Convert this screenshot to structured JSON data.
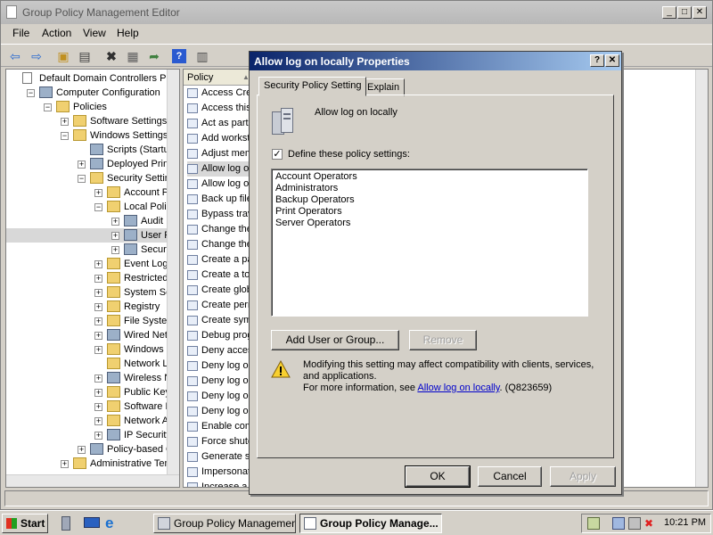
{
  "window": {
    "title": "Group Policy Management Editor",
    "min": "_",
    "max": "□",
    "close": "✕"
  },
  "menu": [
    "File",
    "Action",
    "View",
    "Help"
  ],
  "tree": [
    {
      "label": "Default Domain Controllers Polic",
      "indent": 0,
      "exp": "",
      "icon": "doc"
    },
    {
      "label": "Computer Configuration",
      "indent": 1,
      "exp": "−",
      "icon": "gear"
    },
    {
      "label": "Policies",
      "indent": 2,
      "exp": "−",
      "icon": "folder"
    },
    {
      "label": "Software Settings",
      "indent": 3,
      "exp": "+",
      "icon": "folder"
    },
    {
      "label": "Windows Settings",
      "indent": 3,
      "exp": "−",
      "icon": "folder"
    },
    {
      "label": "Scripts (Startup",
      "indent": 4,
      "exp": "",
      "icon": "gear"
    },
    {
      "label": "Deployed Printe",
      "indent": 4,
      "exp": "+",
      "icon": "gear"
    },
    {
      "label": "Security Setting",
      "indent": 4,
      "exp": "−",
      "icon": "lock"
    },
    {
      "label": "Account Pol",
      "indent": 5,
      "exp": "+",
      "icon": "folder"
    },
    {
      "label": "Local Policie",
      "indent": 5,
      "exp": "−",
      "icon": "folder"
    },
    {
      "label": "Audit Po",
      "indent": 6,
      "exp": "+",
      "icon": "gear"
    },
    {
      "label": "User Rig",
      "indent": 6,
      "exp": "+",
      "icon": "gear"
    },
    {
      "label": "Security",
      "indent": 6,
      "exp": "+",
      "icon": "gear"
    },
    {
      "label": "Event Log",
      "indent": 5,
      "exp": "+",
      "icon": "folder"
    },
    {
      "label": "Restricted G",
      "indent": 5,
      "exp": "+",
      "icon": "lock"
    },
    {
      "label": "System Serv",
      "indent": 5,
      "exp": "+",
      "icon": "lock"
    },
    {
      "label": "Registry",
      "indent": 5,
      "exp": "+",
      "icon": "lock"
    },
    {
      "label": "File System",
      "indent": 5,
      "exp": "+",
      "icon": "lock"
    },
    {
      "label": "Wired Netw",
      "indent": 5,
      "exp": "+",
      "icon": "gear"
    },
    {
      "label": "Windows Fir",
      "indent": 5,
      "exp": "+",
      "icon": "folder"
    },
    {
      "label": "Network Lis",
      "indent": 5,
      "exp": "",
      "icon": "folder"
    },
    {
      "label": "Wireless Ne",
      "indent": 5,
      "exp": "+",
      "icon": "gear"
    },
    {
      "label": "Public Key P",
      "indent": 5,
      "exp": "+",
      "icon": "folder"
    },
    {
      "label": "Software Re",
      "indent": 5,
      "exp": "+",
      "icon": "folder"
    },
    {
      "label": "Network Ac",
      "indent": 5,
      "exp": "+",
      "icon": "folder"
    },
    {
      "label": "IP Security",
      "indent": 5,
      "exp": "+",
      "icon": "gear"
    },
    {
      "label": "Policy-based Qo",
      "indent": 4,
      "exp": "+",
      "icon": "gear"
    },
    {
      "label": "Administrative Temp",
      "indent": 3,
      "exp": "+",
      "icon": "folder"
    }
  ],
  "list": {
    "column": "Policy",
    "items": [
      "Access Cre",
      "Access this",
      "Act as part",
      "Add workst",
      "Adjust mem",
      "Allow log on",
      "Allow log on",
      "Back up file",
      "Bypass trav",
      "Change the",
      "Change the",
      "Create a pa",
      "Create a to",
      "Create glob",
      "Create perm",
      "Create sym",
      "Debug prog",
      "Deny acces",
      "Deny log on",
      "Deny log on",
      "Deny log on",
      "Deny log on",
      "Enable com",
      "Force shutd",
      "Generate se",
      "Impersonat",
      "Increase a"
    ]
  },
  "dialog": {
    "title": "Allow log on locally Properties",
    "help": "?",
    "close": "✕",
    "tabs": [
      "Security Policy Setting",
      "Explain"
    ],
    "policy_name": "Allow log on locally",
    "define_label": "Define these policy settings:",
    "define_checked": "✓",
    "groups": [
      "Account Operators",
      "Administrators",
      "Backup Operators",
      "Print Operators",
      "Server Operators"
    ],
    "add_button": "Add User or Group...",
    "remove_button": "Remove",
    "warning_line1": "Modifying this setting may affect compatibility with clients, services,",
    "warning_line2": "and applications.",
    "info_prefix": "For more information, see",
    "info_link": "Allow log on locally",
    "info_suffix": ". (Q823659)",
    "ok": "OK",
    "cancel": "Cancel",
    "apply": "Apply"
  },
  "taskbar": {
    "start": "Start",
    "tasks": [
      "Group Policy Management",
      "Group Policy Manage..."
    ],
    "clock": "10:21 PM"
  }
}
